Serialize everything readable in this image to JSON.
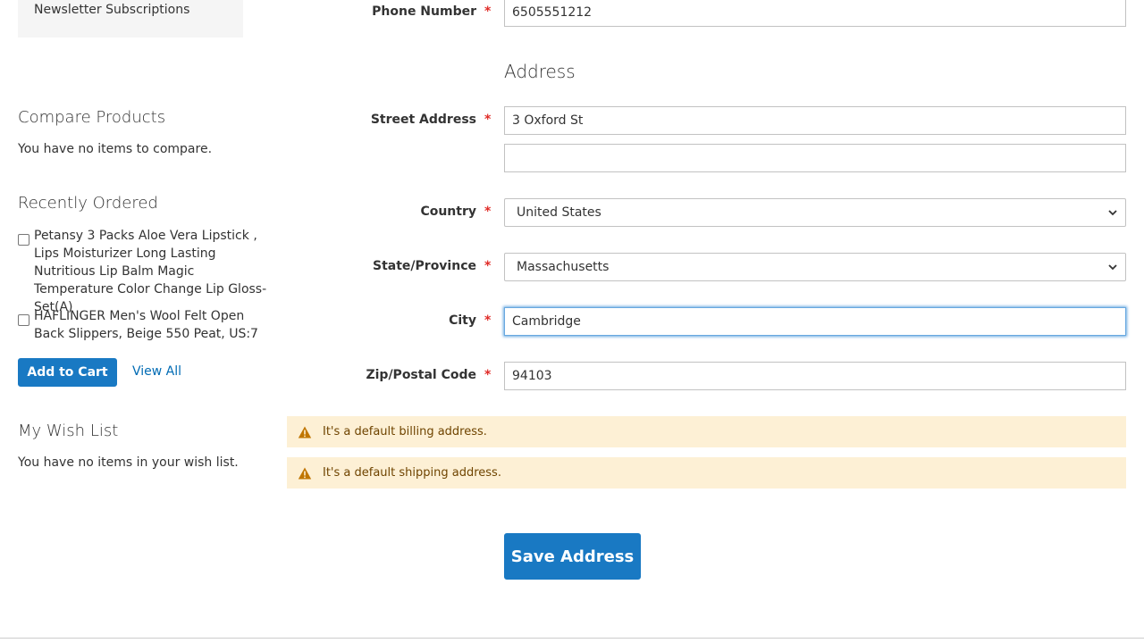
{
  "sidebar": {
    "nav_link": "Newsletter Subscriptions",
    "compare": {
      "title": "Compare Products",
      "empty_text": "You have no items to compare."
    },
    "recently_ordered": {
      "title": "Recently Ordered",
      "items": [
        {
          "name": "Petansy 3 Packs Aloe Vera Lipstick , Lips Moisturizer Long Lasting Nutritious Lip Balm Magic Temperature Color Change Lip Gloss-Set(A)",
          "checked": false
        },
        {
          "name": "HAFLINGER Men's Wool Felt Open Back Slippers, Beige 550 Peat, US:7",
          "checked": false
        }
      ],
      "add_to_cart_label": "Add to Cart",
      "view_all_label": "View All"
    },
    "wishlist": {
      "title": "My Wish List",
      "empty_text": "You have no items in your wish list."
    }
  },
  "form": {
    "required_mark": "*",
    "phone": {
      "label": "Phone Number",
      "value": "6505551212"
    },
    "address_section_title": "Address",
    "street": {
      "label": "Street Address",
      "line1": "3 Oxford St",
      "line2": ""
    },
    "country": {
      "label": "Country",
      "value": "United States"
    },
    "state": {
      "label": "State/Province",
      "value": "Massachusetts"
    },
    "city": {
      "label": "City",
      "value": "Cambridge",
      "focused": true
    },
    "zip": {
      "label": "Zip/Postal Code",
      "value": "94103"
    },
    "notices": [
      {
        "text": "It's a default billing address.",
        "icon": "warning-icon"
      },
      {
        "text": "It's a default shipping address.",
        "icon": "warning-icon"
      }
    ],
    "save_label": "Save Address"
  },
  "colors": {
    "primary": "#1979c3",
    "link": "#006bb4",
    "required": "#e02b27",
    "notice_bg": "#fdf0d5",
    "notice_text": "#6f4400",
    "warning_icon": "#c07600"
  }
}
